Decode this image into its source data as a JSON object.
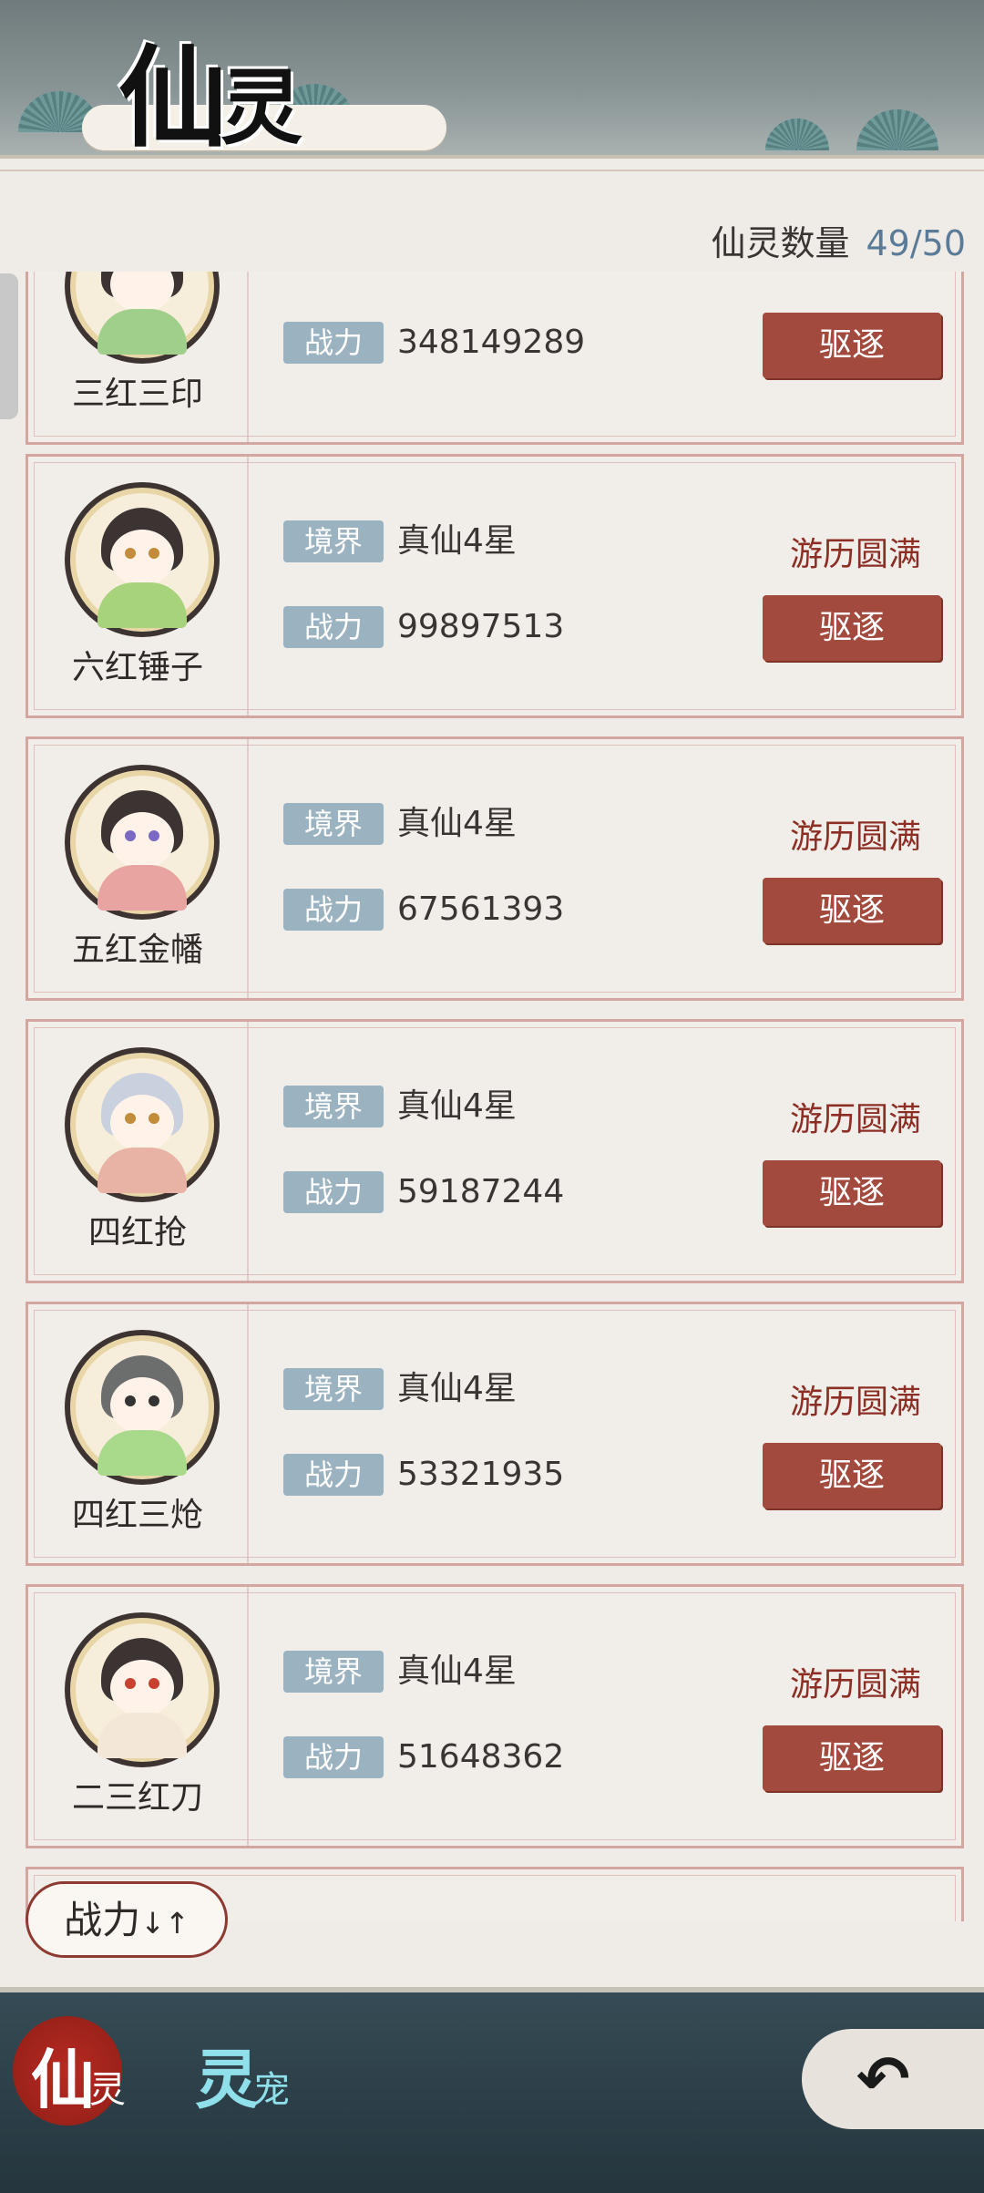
{
  "header": {
    "title_main": "仙",
    "title_second": "灵"
  },
  "count": {
    "label": "仙灵数量",
    "value": "49/50"
  },
  "labels": {
    "realm": "境界",
    "power": "战力",
    "evict": "驱逐"
  },
  "cards": [
    {
      "name": "三红三印",
      "realm": "",
      "power": "348149289",
      "status": ""
    },
    {
      "name": "六红锤子",
      "realm": "真仙4星",
      "power": "99897513",
      "status": "游历圆满"
    },
    {
      "name": "五红金幡",
      "realm": "真仙4星",
      "power": "67561393",
      "status": "游历圆满"
    },
    {
      "name": "四红抢",
      "realm": "真仙4星",
      "power": "59187244",
      "status": "游历圆满"
    },
    {
      "name": "四红三炝",
      "realm": "真仙4星",
      "power": "53321935",
      "status": "游历圆满"
    },
    {
      "name": "二三红刀",
      "realm": "真仙4星",
      "power": "51648362",
      "status": "游历圆满"
    }
  ],
  "sort": {
    "label": "战力",
    "icon": "sort-arrows-icon",
    "arrows": "↓↑"
  },
  "tabs": [
    {
      "big": "仙",
      "small": "灵",
      "active": true
    },
    {
      "big": "灵",
      "small": "宠",
      "active": false
    }
  ],
  "colors": {
    "accent_red": "#a14a3d",
    "tag_blue": "#9bb3c0",
    "status_red": "#8c2e24",
    "count_blue": "#5a7b98"
  }
}
